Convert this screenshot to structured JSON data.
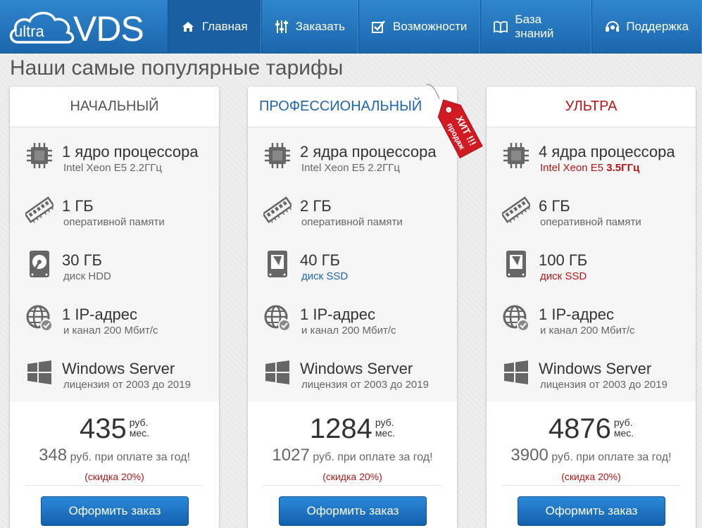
{
  "header": {
    "logo_small": "ultra",
    "logo_big": "VDS",
    "nav": [
      {
        "label": "Главная",
        "icon": "home-icon"
      },
      {
        "label": "Заказать",
        "icon": "sliders-icon"
      },
      {
        "label": "Возможности",
        "icon": "checkbox-icon"
      },
      {
        "label": "База знаний",
        "icon": "book-icon"
      },
      {
        "label": "Поддержка",
        "icon": "headset-icon"
      }
    ]
  },
  "page_title": "Наши самые популярные тарифы",
  "hit_tag": {
    "line1": "ХИТ !!!",
    "line2": "продаж"
  },
  "colors": {
    "accent_blue": "#1d66ae",
    "accent_red": "#b31818"
  },
  "plans": [
    {
      "name": "НАЧАЛЬНЫЙ",
      "cpu": {
        "title": "1 ядро процессора",
        "sub": "Intel Xeon E5 2.2ГГц"
      },
      "ram": {
        "title": "1 ГБ",
        "sub": "оперативной памяти"
      },
      "disk": {
        "title": "30 ГБ",
        "sub_prefix": "диск",
        "sub_type": "HDD"
      },
      "ip": {
        "title": "1 IP-адрес",
        "sub": "и канал 200 Мбит/с"
      },
      "os": {
        "title": "Windows Server",
        "sub": "лицензия от 2003 до 2019"
      },
      "price": "435",
      "rub": "руб.",
      "per": "мес.",
      "year_price": "348",
      "year_text": "руб. при оплате за год!",
      "discount": "(скидка 20%)",
      "button": "Оформить заказ"
    },
    {
      "name": "ПРОФЕССИОНАЛЬНЫЙ",
      "cpu": {
        "title": "2 ядра процессора",
        "sub": "Intel Xeon E5 2.2ГГц"
      },
      "ram": {
        "title": "2 ГБ",
        "sub": "оперативной памяти"
      },
      "disk": {
        "title": "40 ГБ",
        "sub_prefix": "диск",
        "sub_type": "SSD"
      },
      "ip": {
        "title": "1 IP-адрес",
        "sub": "и канал 200 Мбит/с"
      },
      "os": {
        "title": "Windows Server",
        "sub": "лицензия от 2003 до 2019"
      },
      "price": "1284",
      "rub": "руб.",
      "per": "мес.",
      "year_price": "1027",
      "year_text": "руб. при оплате за год!",
      "discount": "(скидка 20%)",
      "button": "Оформить заказ"
    },
    {
      "name": "УЛЬТРА",
      "cpu": {
        "title": "4 ядра процессора",
        "sub": "Intel Xeon E5",
        "sub_bold": "3.5ГГц"
      },
      "ram": {
        "title": "6 ГБ",
        "sub": "оперативной памяти"
      },
      "disk": {
        "title": "100 ГБ",
        "sub_prefix": "диск",
        "sub_type": "SSD"
      },
      "ip": {
        "title": "1 IP-адрес",
        "sub": "и канал 200 Мбит/с"
      },
      "os": {
        "title": "Windows Server",
        "sub": "лицензия от 2003 до 2019"
      },
      "price": "4876",
      "rub": "руб.",
      "per": "мес.",
      "year_price": "3900",
      "year_text": "руб. при оплате за год!",
      "discount": "(скидка 20%)",
      "button": "Оформить заказ"
    }
  ]
}
